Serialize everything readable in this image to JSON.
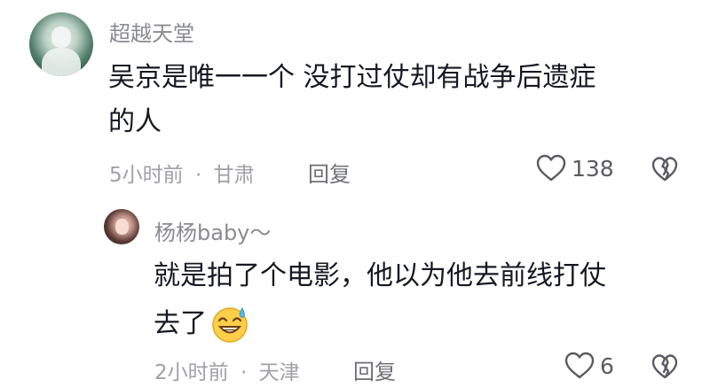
{
  "comments": [
    {
      "username": "超越天堂",
      "text_lines": [
        "吴京是唯一一个  没打过仗却有战争后遗症",
        "的人"
      ],
      "time": "5小时前",
      "location": "甘肃",
      "reply_label": "回复",
      "like_count": "138",
      "avatar_icon": "user-avatar",
      "like_icon": "heart-outline-icon",
      "dislike_icon": "broken-heart-icon"
    },
    {
      "username": "杨杨baby～",
      "text_lines": [
        "就是拍了个电影，他以为他去前线打仗",
        "去了"
      ],
      "emoji": "laughing-sweat-emoji",
      "time": "2小时前",
      "location": "天津",
      "reply_label": "回复",
      "like_count": "6",
      "avatar_icon": "user-avatar",
      "like_icon": "heart-outline-icon",
      "dislike_icon": "broken-heart-icon"
    }
  ],
  "separator": "·",
  "colors": {
    "text": "#161823",
    "username": "#8a8b91",
    "meta": "#a0a1a6",
    "emoji_face": "#ffcf4a"
  }
}
